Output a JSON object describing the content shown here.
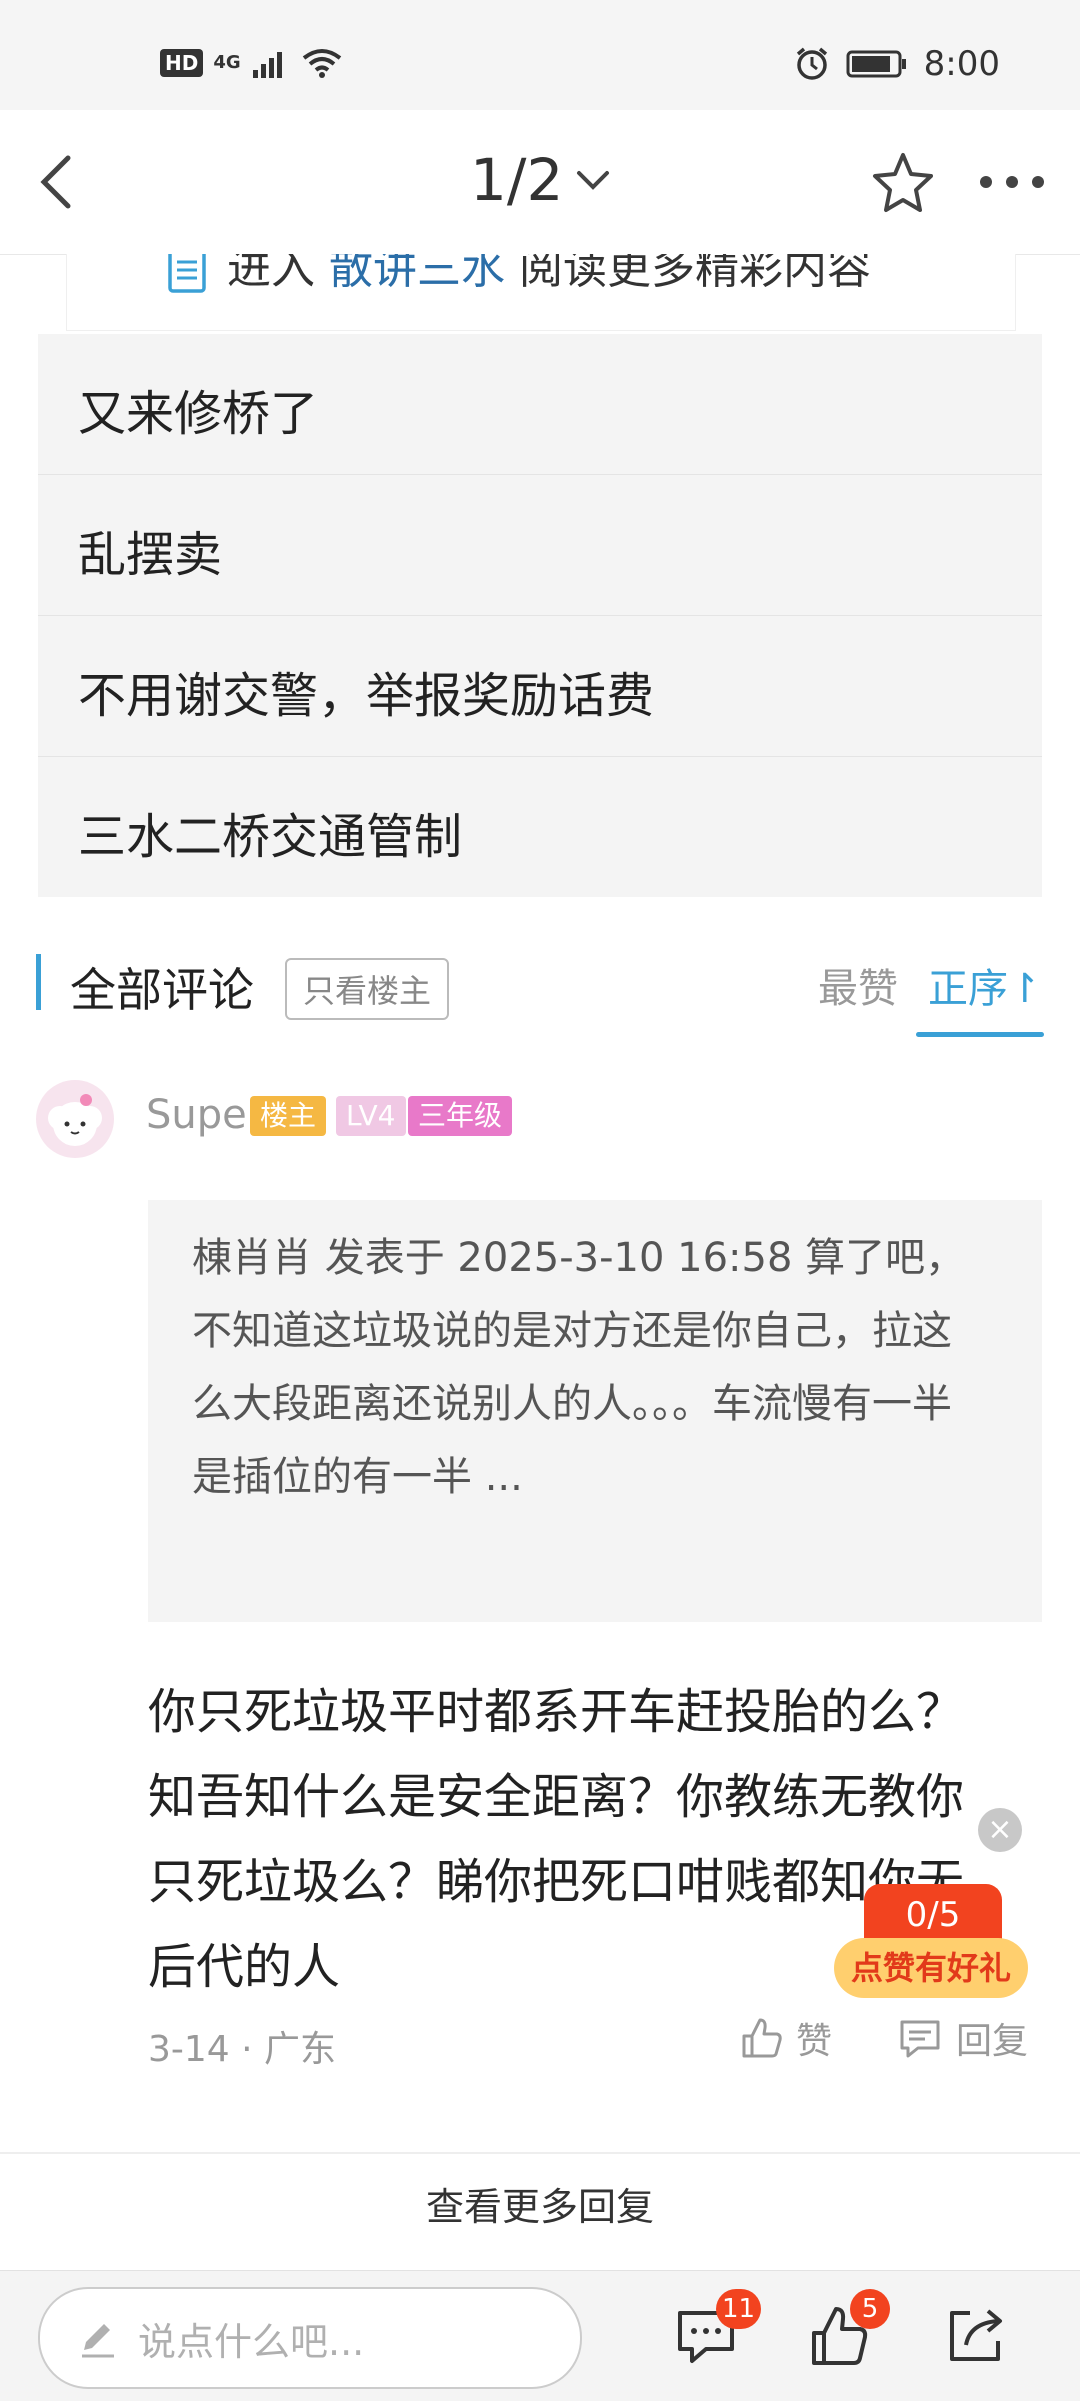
{
  "status_bar": {
    "hd_label": "HD",
    "network_label": "4G",
    "time": "8:00"
  },
  "nav": {
    "page_indicator": "1/2"
  },
  "forum_card": {
    "prefix": "进入",
    "forum_name": "散讲三水",
    "suffix": "阅读更多精彩内容"
  },
  "related_threads": [
    {
      "title": "又来修桥了"
    },
    {
      "title": "乱摆卖"
    },
    {
      "title": "不用谢交警，举报奖励话费"
    },
    {
      "title": "三水二桥交通管制"
    }
  ],
  "comments_header": {
    "title": "全部评论",
    "filter_label": "只看楼主",
    "sort_best": "最赞",
    "sort_order": "正序↾"
  },
  "comment": {
    "username": "Supe",
    "badge_owner": "楼主",
    "badge_level": "LV4",
    "badge_grade": "三年级",
    "quote": "棟肖肖 发表于 2025-3-10 16:58 算了吧，不知道这垃圾说的是对方还是你自己，拉这么大段距离还说别人的人。。。车流慢有一半是插位的有一半 ...",
    "reply": "你只死垃圾平时都系开车赶投胎的么？知吾知什么是安全距离？你教练无教你只死垃圾么？睇你把死口咁贱都知你无后代的人",
    "meta": "3-14 · 广东",
    "like_label": "赞",
    "reply_label": "回复"
  },
  "promo": {
    "count": "0/5",
    "label": "点赞有好礼",
    "close_symbol": "×"
  },
  "more_replies": "查看更多回复",
  "bottom_bar": {
    "input_placeholder": "说点什么吧...",
    "comment_count": "11",
    "like_count": "5"
  },
  "colors": {
    "accent": "#3aa0d6",
    "badge_red": "#f2431f",
    "link": "#2b6ea8"
  }
}
